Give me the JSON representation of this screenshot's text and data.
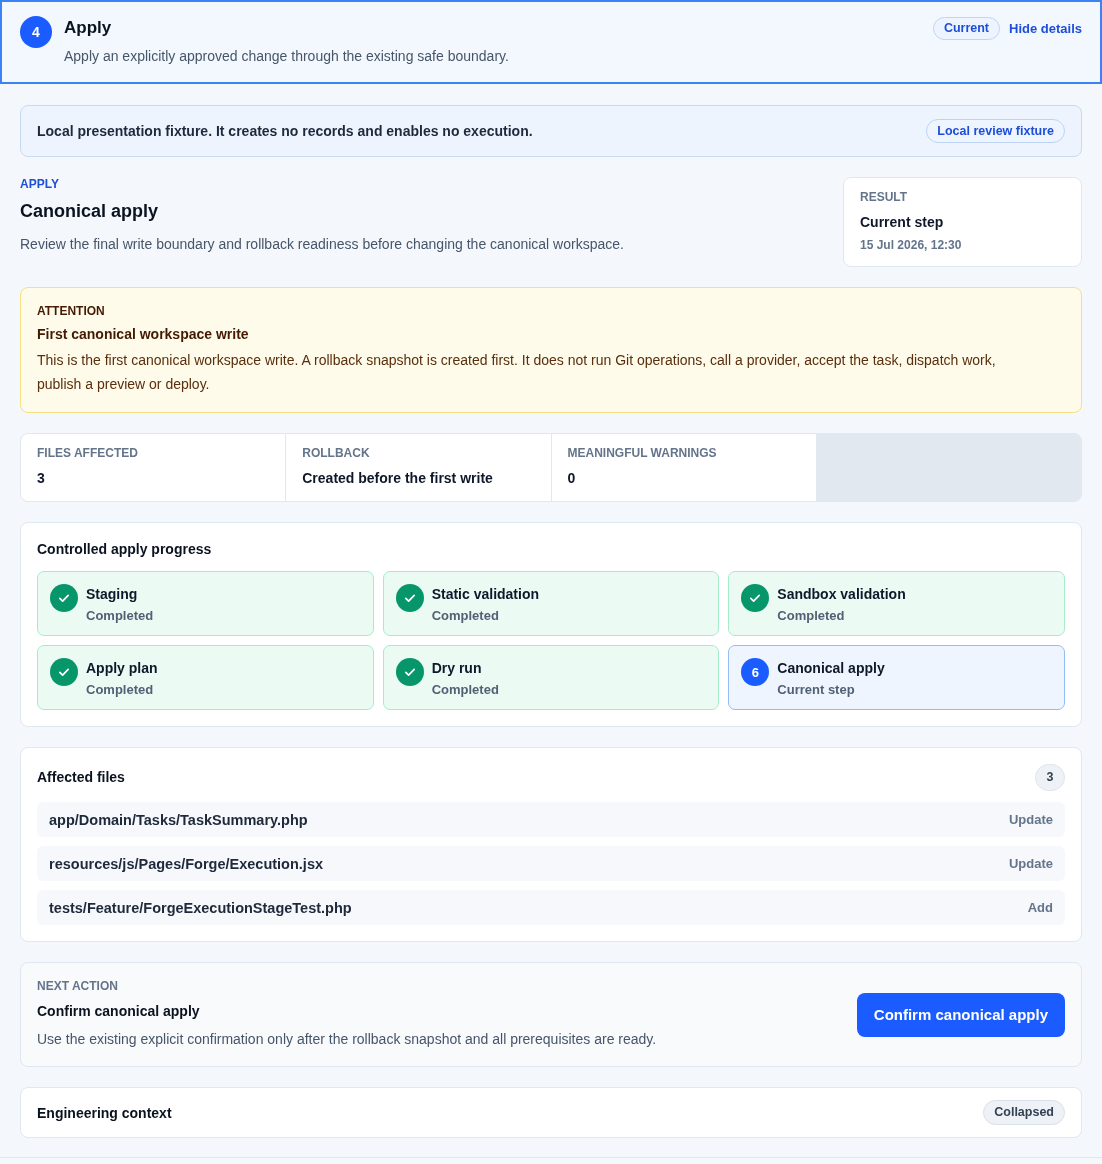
{
  "header": {
    "step_number": "4",
    "title": "Apply",
    "subtitle": "Apply an explicitly approved change through the existing safe boundary.",
    "status_badge": "Current",
    "details_link": "Hide details"
  },
  "notice": {
    "text": "Local presentation fixture. It creates no records and enables no execution.",
    "badge": "Local review fixture"
  },
  "intro": {
    "eyebrow": "APPLY",
    "title": "Canonical apply",
    "description": "Review the final write boundary and rollback readiness before changing the canonical workspace."
  },
  "result": {
    "label": "RESULT",
    "value": "Current step",
    "timestamp": "15 Jul 2026, 12:30"
  },
  "attention": {
    "label": "ATTENTION",
    "title": "First canonical workspace write",
    "body": "This is the first canonical workspace write. A rollback snapshot is created first. It does not run Git operations, call a provider, accept the task, dispatch work, publish a preview or deploy."
  },
  "stats": [
    {
      "label": "FILES AFFECTED",
      "value": "3"
    },
    {
      "label": "ROLLBACK",
      "value": "Created before the first write"
    },
    {
      "label": "MEANINGFUL WARNINGS",
      "value": "0"
    }
  ],
  "progress": {
    "title": "Controlled apply progress",
    "steps": [
      {
        "kind": "completed",
        "name": "Staging",
        "status": "Completed"
      },
      {
        "kind": "completed",
        "name": "Static validation",
        "status": "Completed"
      },
      {
        "kind": "completed",
        "name": "Sandbox validation",
        "status": "Completed"
      },
      {
        "kind": "completed",
        "name": "Apply plan",
        "status": "Completed"
      },
      {
        "kind": "completed",
        "name": "Dry run",
        "status": "Completed"
      },
      {
        "kind": "current",
        "number": "6",
        "name": "Canonical apply",
        "status": "Current step"
      }
    ]
  },
  "affected_files": {
    "title": "Affected files",
    "count": "3",
    "files": [
      {
        "path": "app/Domain/Tasks/TaskSummary.php",
        "action": "Update"
      },
      {
        "path": "resources/js/Pages/Forge/Execution.jsx",
        "action": "Update"
      },
      {
        "path": "tests/Feature/ForgeExecutionStageTest.php",
        "action": "Add"
      }
    ]
  },
  "next_action": {
    "label": "NEXT ACTION",
    "title": "Confirm canonical apply",
    "description": "Use the existing explicit confirmation only after the rollback snapshot and all prerequisites are ready.",
    "button": "Confirm canonical apply"
  },
  "engineering_context": {
    "title": "Engineering context",
    "status_badge": "Collapsed"
  }
}
